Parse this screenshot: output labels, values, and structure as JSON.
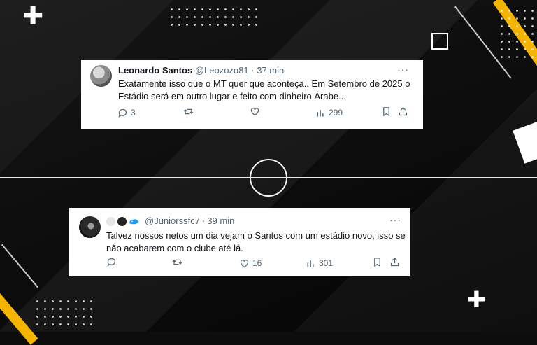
{
  "tweets": [
    {
      "author_name": "Leonardo Santos",
      "handle": "@Leozozo81",
      "separator": "·",
      "time": "37 min",
      "more": "···",
      "text_line1": "Exatamente isso que o MT quer que aconteça.. Em Setembro de 2025 o",
      "text_line2": "Estádio será em outro lugar e feito com dinheiro Árabe...",
      "replies": "3",
      "retweets": "",
      "likes": "",
      "views": "299"
    },
    {
      "author_name": "",
      "handle": "@Juniorssfc7",
      "separator": "·",
      "time": "39 min",
      "more": "···",
      "text_line1": "Talvez nossos netos um dia vejam o Santos com um estádio novo, isso se",
      "text_line2": "não acabarem com o clube até lá.",
      "replies": "",
      "retweets": "",
      "likes": "16",
      "views": "301"
    }
  ],
  "decorations": {
    "plus_glyph": "✚",
    "accent_color": "#f5b400"
  },
  "icons": [
    "reply-icon",
    "retweet-icon",
    "like-icon",
    "views-icon",
    "bookmark-icon",
    "share-icon",
    "more-icon",
    "plus-icon"
  ]
}
